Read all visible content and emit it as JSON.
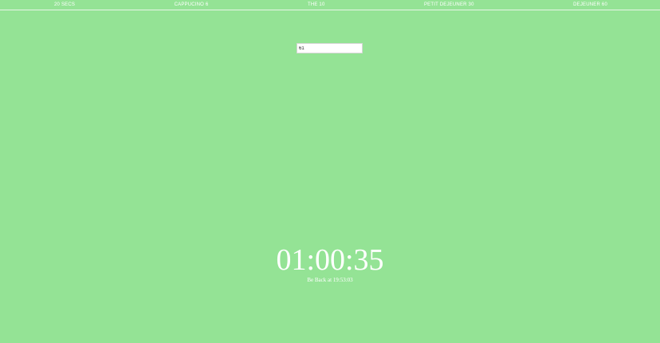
{
  "nav": {
    "items": [
      {
        "label": "20 SECS"
      },
      {
        "label": "CAPPUCINO 6"
      },
      {
        "label": "THE 10"
      },
      {
        "label": "PETIT DEJEUNER 30"
      },
      {
        "label": "DEJEUNER 60"
      }
    ]
  },
  "input": {
    "value": "61",
    "placeholder": ""
  },
  "timer": {
    "display": "01:00:35",
    "back_at": "Be Back at 19:53:03"
  },
  "colors": {
    "background": "#94e395",
    "text": "#ffffff"
  }
}
